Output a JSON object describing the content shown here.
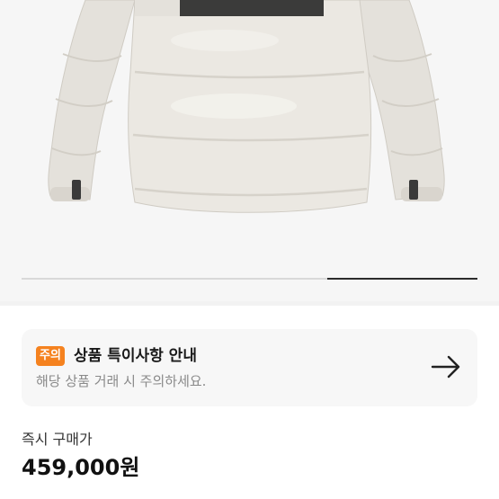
{
  "product_image": {
    "description_icon": "jacket-image",
    "carousel_progress": 0.33
  },
  "notice": {
    "badge": "주의",
    "title": "상품 특이사항 안내",
    "description": "해당 상품 거래 시 주의하세요.",
    "arrow_icon": "arrow-right-icon"
  },
  "price": {
    "label": "즉시 구매가",
    "value": "459,000원"
  },
  "colors": {
    "badge": "#f5821f",
    "background": "#ffffff",
    "card": "#f7f7f7"
  }
}
